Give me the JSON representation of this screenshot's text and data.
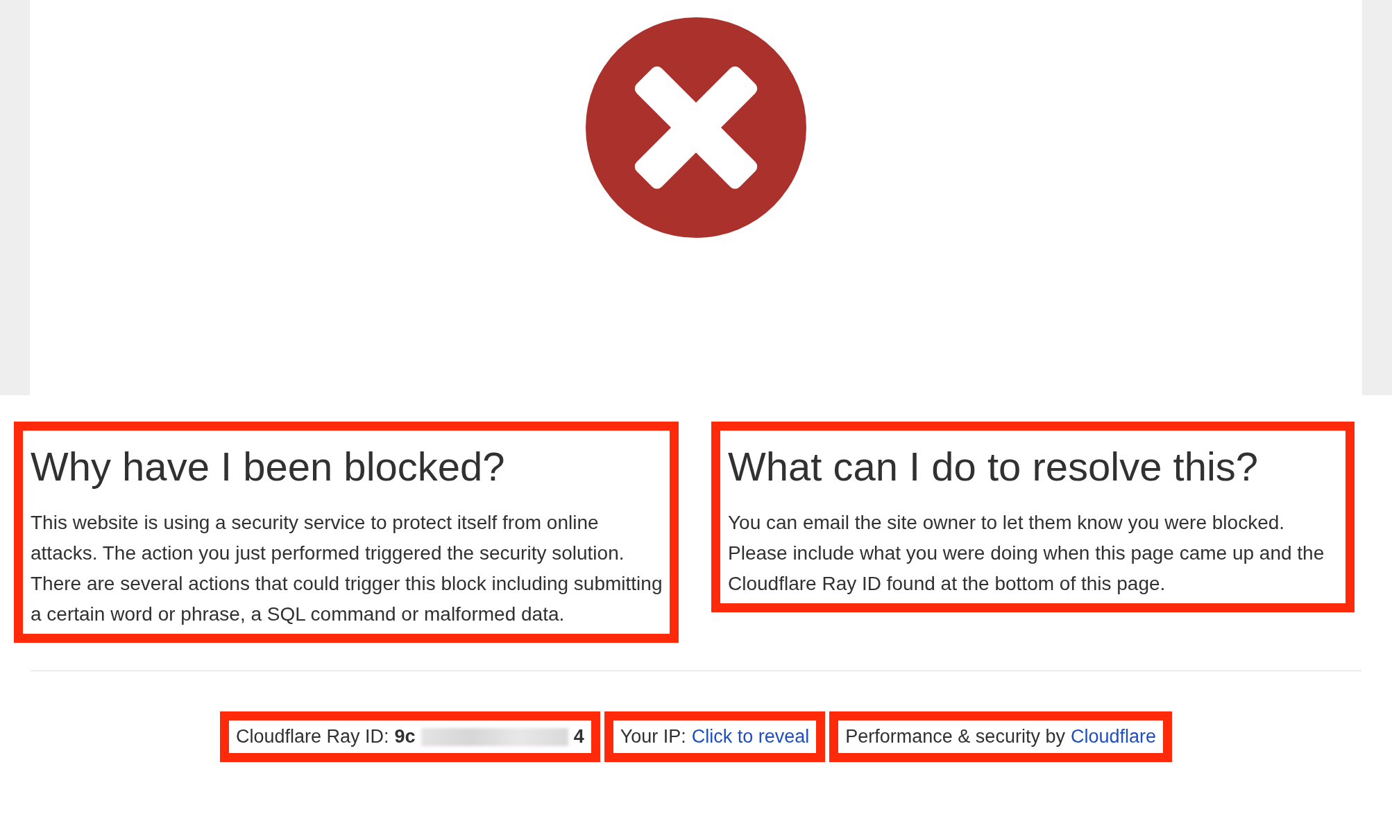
{
  "sections": [
    {
      "heading": "Why have I been blocked?",
      "text": "This website is using a security service to protect itself from online attacks. The action you just performed triggered the security solution. There are several actions that could trigger this block including submitting a certain word or phrase, a SQL command or malformed data.",
      "highlighted": true
    },
    {
      "heading": "What can I do to resolve this?",
      "text": "You can email the site owner to let them know you were blocked. Please include what you were doing when this page came up and the Cloudflare Ray ID found at the bottom of this page.",
      "highlighted": true
    }
  ],
  "footer": [
    {
      "kind": "ray",
      "label": "Cloudflare Ray ID:",
      "value_start": "9c",
      "value_end": "4",
      "highlighted": true
    },
    {
      "kind": "link",
      "label": "Your IP:",
      "link": "Click to reveal",
      "highlighted": true
    },
    {
      "kind": "link",
      "label": "Performance & security by",
      "link": "Cloudflare",
      "highlighted": true
    }
  ]
}
